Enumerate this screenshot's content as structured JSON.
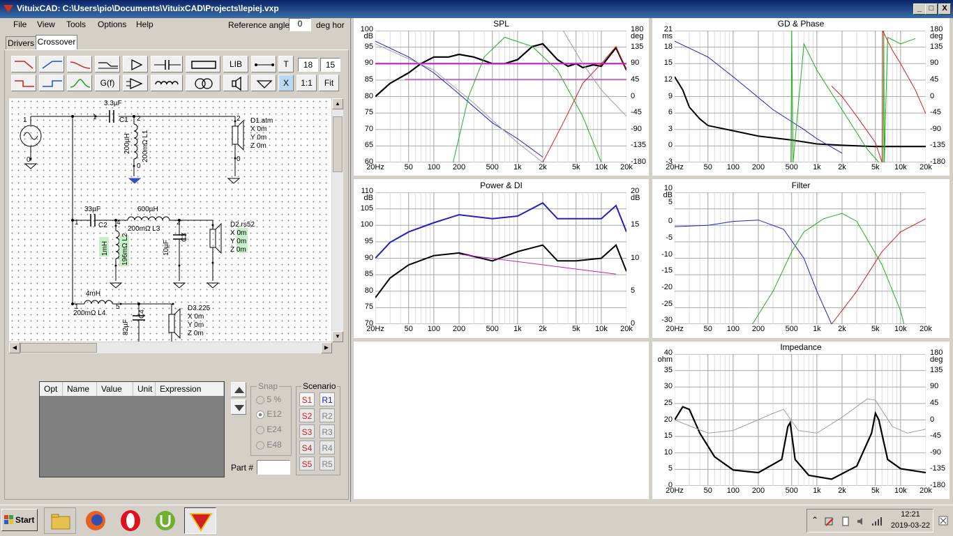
{
  "window": {
    "title": "VituixCAD: C:\\Users\\pio\\Documents\\VituixCAD\\Projects\\lepiej.vxp",
    "minimize": "_",
    "restore": "□",
    "close": "X"
  },
  "menu": [
    "File",
    "View",
    "Tools",
    "Options",
    "Help"
  ],
  "reference": {
    "label": "Reference angle",
    "value": "0",
    "unit": "deg hor"
  },
  "tabs": [
    "Drivers",
    "Crossover"
  ],
  "toolbar": {
    "lib": "LIB",
    "t": "T",
    "v1": "18",
    "v2": "15",
    "gf": "G(f)",
    "x": "X",
    "one": "1:1",
    "fit": "Fit"
  },
  "schematic": {
    "c1_val": "3.3µF",
    "c1_name": "C1",
    "l1_val": "200µH",
    "l1_res": "200mΩ L1",
    "d1": [
      "D1.atm",
      "X 0m",
      "Y 0m",
      "Z 0m"
    ],
    "c2_val": "33µF",
    "c2_name": "C2",
    "l3_val": "600µH",
    "l3_res": "200mΩ L3",
    "l2_val": "1mH",
    "l2_res": "196mΩ L2",
    "c3_val": "10µF",
    "c3_name": "C3",
    "d2": [
      "D2.rs52",
      "X 0m",
      "Y 0m",
      "Z 0m"
    ],
    "l4_val": "4mH",
    "l4_res": "200mΩ L4",
    "c4_val": "82µF",
    "c4_name": "C4",
    "d3": [
      "D3.225",
      "X 0m",
      "Y 0m",
      "Z 0m"
    ],
    "nodes": [
      "1",
      "0",
      "2",
      "3",
      "4",
      "5",
      "1",
      "4",
      "2",
      "3",
      "0",
      "1",
      "4",
      "5",
      "1",
      "0"
    ]
  },
  "optimizer": {
    "columns": [
      "Opt",
      "Name",
      "Value",
      "Unit",
      "Expression"
    ],
    "part_label": "Part #"
  },
  "snap": {
    "title": "Snap",
    "options": [
      "5 %",
      "E12",
      "E24",
      "E48"
    ],
    "selected": "E12"
  },
  "scenario": {
    "title": "Scenario",
    "s": [
      "S1",
      "S2",
      "S3",
      "S4",
      "S5"
    ],
    "r": [
      "R1",
      "R2",
      "R3",
      "R4",
      "R5"
    ]
  },
  "graphs": {
    "spl": {
      "title": "SPL",
      "ylab_left": [
        "100",
        "dB"
      ],
      "yticks_left": [
        "95",
        "90",
        "85",
        "80",
        "75",
        "70",
        "65",
        "60"
      ],
      "ylab_right": [
        "180",
        "deg"
      ],
      "yticks_right": [
        "135",
        "90",
        "45",
        "0",
        "-45",
        "-90",
        "-135",
        "-180"
      ],
      "xticks": [
        "20Hz",
        "50",
        "100",
        "200",
        "500",
        "1k",
        "2k",
        "5k",
        "10k",
        "20k"
      ]
    },
    "gd": {
      "title": "GD & Phase",
      "ylab_left": [
        "21",
        "ms"
      ],
      "yticks_left": [
        "18",
        "15",
        "12",
        "9",
        "6",
        "3",
        "0",
        "-3"
      ],
      "ylab_right": [
        "180",
        "deg"
      ],
      "yticks_right": [
        "135",
        "90",
        "45",
        "0",
        "-45",
        "-90",
        "-135",
        "-180"
      ],
      "xticks": [
        "20Hz",
        "50",
        "100",
        "200",
        "500",
        "1k",
        "2k",
        "5k",
        "10k",
        "20k"
      ]
    },
    "power": {
      "title": "Power & DI",
      "ylab_left": [
        "110",
        "dB"
      ],
      "yticks_left": [
        "105",
        "100",
        "95",
        "90",
        "85",
        "80",
        "75",
        "70"
      ],
      "ylab_right": [
        "20",
        "dB"
      ],
      "yticks_right": [
        "15",
        "10",
        "5",
        "0"
      ],
      "xticks": [
        "20Hz",
        "50",
        "100",
        "200",
        "500",
        "1k",
        "2k",
        "5k",
        "10k",
        "20k"
      ]
    },
    "filter": {
      "title": "Filter",
      "yticks_left": [
        "10",
        "dB",
        "5",
        "0",
        "-5",
        "-10",
        "-15",
        "-20",
        "-25",
        "-30"
      ],
      "xticks": [
        "20Hz",
        "50",
        "100",
        "200",
        "500",
        "1k",
        "2k",
        "5k",
        "10k",
        "20k"
      ]
    },
    "imp": {
      "title": "Impedance",
      "ylab_left": [
        "40",
        "ohm"
      ],
      "yticks_left": [
        "35",
        "30",
        "25",
        "20",
        "15",
        "10",
        "5",
        "0"
      ],
      "ylab_right": [
        "180",
        "deg"
      ],
      "yticks_right": [
        "135",
        "90",
        "45",
        "0",
        "-45",
        "-90",
        "-135",
        "-180"
      ],
      "xticks": [
        "20Hz",
        "50",
        "100",
        "200",
        "500",
        "1k",
        "2k",
        "5k",
        "10k",
        "20k"
      ]
    }
  },
  "taskbar": {
    "start": "Start",
    "time": "12:21",
    "date": "2019-03-22"
  },
  "colors": {
    "titlebar": "#0a246a",
    "spl_black": "#000000",
    "red": "#d02020",
    "green": "#20b020",
    "blue": "#2020c0",
    "magenta": "#c020c0",
    "gray": "#a0a0a0"
  }
}
